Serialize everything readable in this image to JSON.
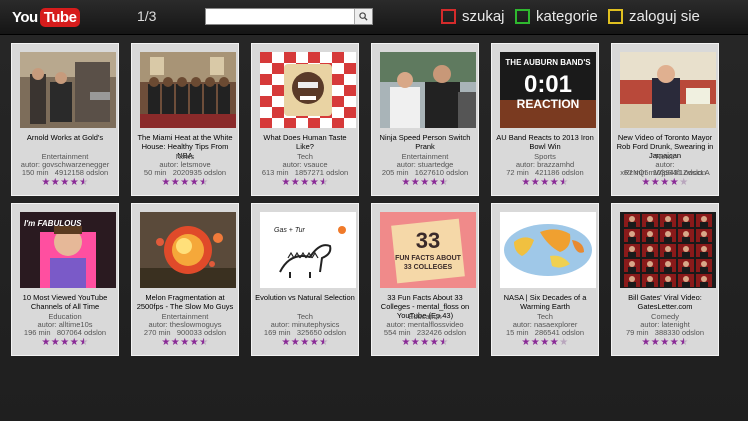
{
  "header": {
    "logo_you": "You",
    "logo_tube": "Tube",
    "pager": "1/3",
    "search": {
      "value": "",
      "placeholder": ""
    },
    "menu": [
      {
        "label": "szukaj",
        "color": "#d42b2b"
      },
      {
        "label": "kategorie",
        "color": "#2fb82f"
      },
      {
        "label": "zaloguj sie",
        "color": "#e0c020"
      }
    ]
  },
  "meta_labels": {
    "author_prefix": "autor: ",
    "duration_unit": " min",
    "views_unit": " odslon"
  },
  "videos": [
    {
      "title": "Arnold Works at Gold's",
      "category": "Entertainment",
      "author": "govschwarzenegger",
      "duration": "150",
      "views": "4912158",
      "rating": 4.5,
      "thumb": "gym"
    },
    {
      "title": "The Miami Heat at the White House: Healthy Tips From NBA",
      "category": "News",
      "author": "letsmove",
      "duration": "50",
      "views": "2020935",
      "rating": 4.5,
      "thumb": "whitehouse"
    },
    {
      "title": "What Does Human Taste Like?",
      "category": "Tech",
      "author": "vsauce",
      "duration": "613",
      "views": "1857271",
      "rating": 4.5,
      "thumb": "sandwich"
    },
    {
      "title": "Ninja Speed Person Switch Prank",
      "category": "Entertainment",
      "author": "stuartedge",
      "duration": "205",
      "views": "1627610",
      "rating": 4.5,
      "thumb": "prank"
    },
    {
      "title": "AU Band Reacts to 2013 Iron Bowl Win",
      "category": "Sports",
      "author": "brazzamhd",
      "duration": "72",
      "views": "421186",
      "rating": 4.5,
      "thumb": "auburn"
    },
    {
      "title": "New Video of Toronto Mayor Rob Ford Drunk, Swearing in Jamaican",
      "category": "News",
      "author": "xRzNQ5mWjpS4f1ZwccLA",
      "duration": "67",
      "views": "1039431",
      "rating": 4,
      "thumb": "mayor"
    },
    {
      "title": "10 Most Viewed YouTube Channels of All Time",
      "category": "Education",
      "author": "alltime10s",
      "duration": "196",
      "views": "807064",
      "rating": 4.5,
      "thumb": "fabulous"
    },
    {
      "title": "Melon Fragmentation at 2500fps - The Slow Mo Guys",
      "category": "Entertainment",
      "author": "theslowmoguys",
      "duration": "270",
      "views": "900033",
      "rating": 4.5,
      "thumb": "melon"
    },
    {
      "title": "Evolution vs Natural Selection",
      "category": "Tech",
      "author": "minutephysics",
      "duration": "169",
      "views": "325650",
      "rating": 4.5,
      "thumb": "dino"
    },
    {
      "title": "33 Fun Facts About 33 Colleges - mental_floss on YouTube (Ep.43)",
      "category": "Education",
      "author": "mentalflossvideo",
      "duration": "554",
      "views": "232426",
      "rating": 4.5,
      "thumb": "facts"
    },
    {
      "title": "NASA | Six Decades of a Warming Earth",
      "category": "Tech",
      "author": "nasaexplorer",
      "duration": "15",
      "views": "286541",
      "rating": 4,
      "thumb": "map"
    },
    {
      "title": "Bill Gates' Viral Video: GatesLetter.com",
      "category": "Comedy",
      "author": "latenight",
      "duration": "79",
      "views": "388330",
      "rating": 4.5,
      "thumb": "gates"
    }
  ],
  "thumb_texts": {
    "auburn_title": "THE AUBURN BAND'S",
    "auburn_time": "0:01",
    "auburn_sub": "REACTION",
    "fabulous": "I'm FABULOUS",
    "facts_num": "33",
    "facts_line1": "FUN FACTS ABOUT",
    "facts_line2": "33 COLLEGES",
    "dino_label": "Gas + Tur"
  }
}
